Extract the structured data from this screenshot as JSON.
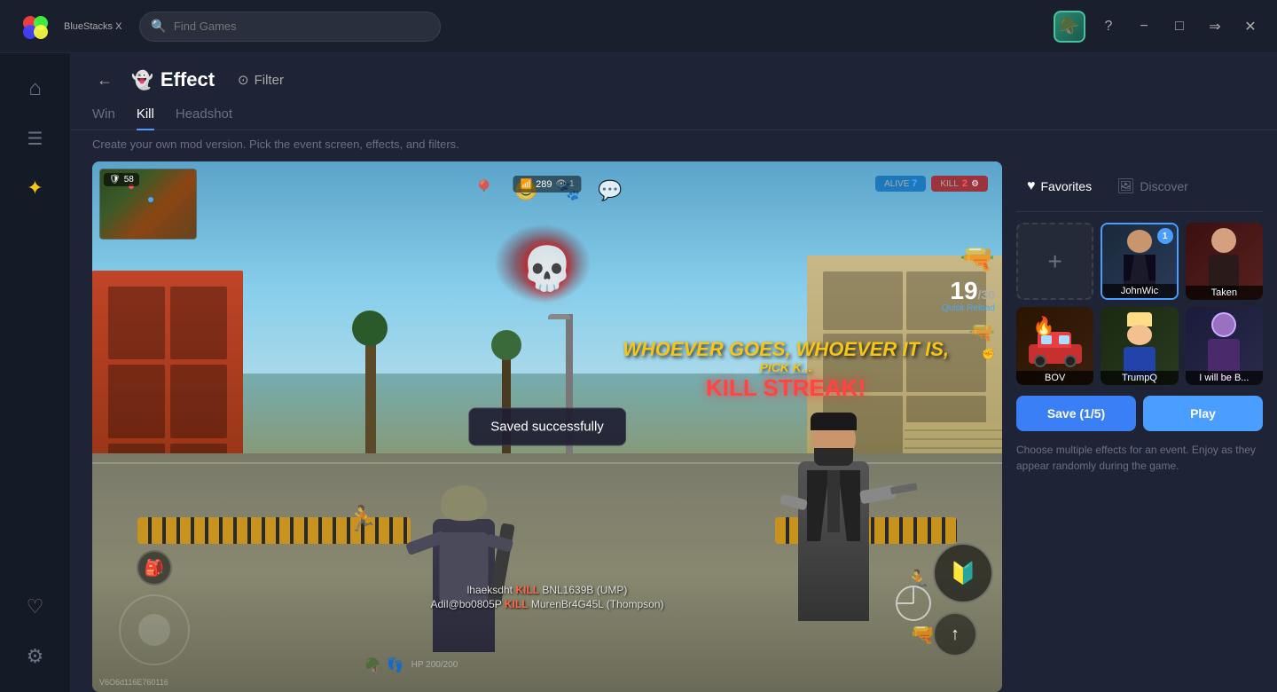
{
  "app": {
    "name": "BlueStacks X",
    "logo_color": "#ff6644"
  },
  "titlebar": {
    "search_placeholder": "Find Games",
    "avatar_emoji": "🪖",
    "help_icon": "?",
    "minimize_label": "−",
    "maximize_label": "□",
    "forward_label": "→",
    "close_label": "×"
  },
  "sidebar": {
    "items": [
      {
        "id": "home",
        "icon": "⌂",
        "label": "Home"
      },
      {
        "id": "library",
        "icon": "☰",
        "label": "Library"
      },
      {
        "id": "effects",
        "icon": "✦",
        "label": "Effects",
        "active": true
      },
      {
        "id": "favorites",
        "icon": "♡",
        "label": "Favorites"
      },
      {
        "id": "settings",
        "icon": "⚙",
        "label": "Settings"
      }
    ]
  },
  "page": {
    "title": "Effect",
    "title_icon": "👻",
    "filter_label": "Filter",
    "back_label": "←"
  },
  "tabs": [
    {
      "id": "win",
      "label": "Win",
      "active": false
    },
    {
      "id": "kill",
      "label": "Kill",
      "active": true
    },
    {
      "id": "headshot",
      "label": "Headshot",
      "active": false
    }
  ],
  "tab_desc": "Create your own mod version. Pick the event screen, effects, and filters.",
  "game": {
    "saved_message": "Saved successfully",
    "score": "58",
    "signal": "289",
    "spectators": "1",
    "alive": "7",
    "kill": "2",
    "ammo_current": "19",
    "ammo_max": "30",
    "ammo_label": "Quick Reload",
    "hp": "HP 200/200",
    "kill_feed_1": "lhaeksdht KILL BNL1639B (UMP)",
    "kill_feed_2": "Adil@bo0805P KILL MurenBr4G45L (Thompson)",
    "whoever_text": "WHOEVER GOES, WHOEVER IT IS,",
    "kill_streak": "KILL STREAK!",
    "bottom_code": "V6O6d116E760116"
  },
  "right_panel": {
    "favorites_label": "Favorites",
    "favorites_icon": "♥",
    "discover_label": "Discover",
    "discover_icon": "🖼",
    "effects": [
      {
        "id": "add",
        "type": "add",
        "label": "+"
      },
      {
        "id": "johnwick",
        "label": "JohnWic",
        "badge": "1",
        "selected": true,
        "bg": "card-johnwick",
        "emoji": "🕵️"
      },
      {
        "id": "taken",
        "label": "Taken",
        "selected": false,
        "bg": "card-taken",
        "emoji": "🔫"
      },
      {
        "id": "bov",
        "label": "BOV",
        "selected": false,
        "bg": "card-bov",
        "emoji": "🚗"
      },
      {
        "id": "trumpq",
        "label": "TrumpQ",
        "selected": false,
        "bg": "card-trumpq",
        "emoji": "🦅"
      },
      {
        "id": "iwillbe",
        "label": "I will be B...",
        "selected": false,
        "bg": "card-iwillbe",
        "emoji": "🕶"
      }
    ],
    "save_btn": "Save (1/5)",
    "play_btn": "Play",
    "desc": "Choose multiple effects for an event. Enjoy as they appear randomly during the game."
  }
}
